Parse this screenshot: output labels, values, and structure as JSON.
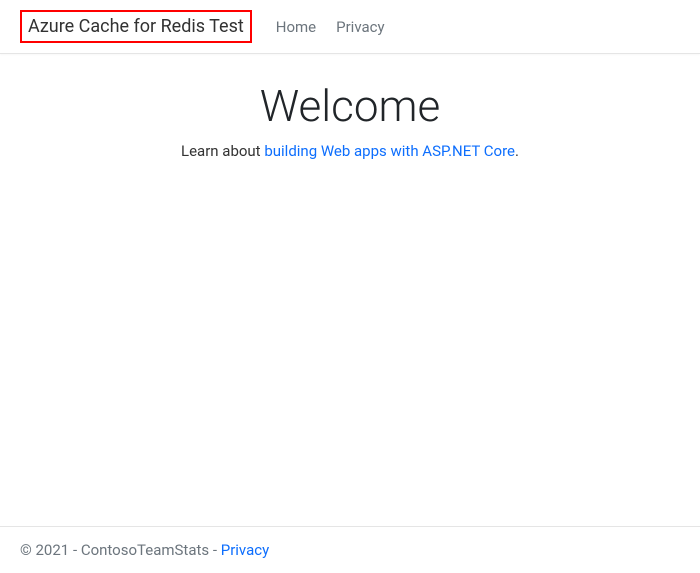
{
  "navbar": {
    "brand": "Azure Cache for Redis Test",
    "links": {
      "home": "Home",
      "privacy": "Privacy"
    }
  },
  "main": {
    "title": "Welcome",
    "subtitle_prefix": "Learn about ",
    "subtitle_link": "building Web apps with ASP.NET Core",
    "subtitle_suffix": "."
  },
  "footer": {
    "copyright": "© 2021 - ContosoTeamStats - ",
    "privacy_link": "Privacy"
  }
}
